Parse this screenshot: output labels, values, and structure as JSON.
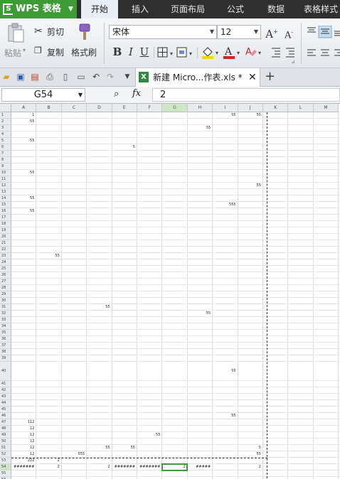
{
  "app": {
    "name": "WPS 表格",
    "logo": "S"
  },
  "menu": {
    "tabs": [
      "开始",
      "插入",
      "页面布局",
      "公式",
      "数据",
      "表格样式"
    ]
  },
  "ribbon": {
    "paste": "粘贴",
    "cut": "剪切",
    "copy": "复制",
    "format_painter": "格式刷",
    "font_name": "宋体",
    "font_size": "12",
    "bold": "B",
    "italic": "I",
    "underline": "U",
    "grow_font": "A",
    "shrink_font": "A"
  },
  "doc_tab": {
    "name": "新建 Micro...作表.xls *",
    "close": "✕",
    "new": "+"
  },
  "formula_bar": {
    "cell_ref": "G54",
    "fx": "fx",
    "value": "2"
  },
  "grid": {
    "columns": [
      "A",
      "B",
      "C",
      "D",
      "E",
      "F",
      "G",
      "H",
      "I",
      "J",
      "K",
      "L",
      "M"
    ],
    "rows": [
      "1",
      "2",
      "3",
      "4",
      "5",
      "6",
      "7",
      "8",
      "9",
      "10",
      "11",
      "12",
      "13",
      "14",
      "15",
      "16",
      "17",
      "18",
      "19",
      "20",
      "21",
      "22",
      "23",
      "24",
      "25",
      "26",
      "27",
      "28",
      "29",
      "30",
      "31",
      "32",
      "33",
      "34",
      "35",
      "36",
      "37",
      "38",
      "39",
      "40",
      "41",
      "42",
      "43",
      "44",
      "45",
      "46",
      "47",
      "48",
      "49",
      "50",
      "51",
      "52",
      "53",
      "54",
      "55",
      "56"
    ],
    "selected": "G54",
    "cells": [
      {
        "col": "A",
        "row": "1",
        "value": "1"
      },
      {
        "col": "A",
        "row": "2",
        "value": "55"
      },
      {
        "col": "A",
        "row": "5",
        "value": "55"
      },
      {
        "col": "A",
        "row": "10",
        "value": "55"
      },
      {
        "col": "A",
        "row": "14",
        "value": "55"
      },
      {
        "col": "A",
        "row": "16",
        "value": "55"
      },
      {
        "col": "A",
        "row": "47",
        "value": "112"
      },
      {
        "col": "A",
        "row": "48",
        "value": "12"
      },
      {
        "col": "A",
        "row": "49",
        "value": "12"
      },
      {
        "col": "A",
        "row": "50",
        "value": "12"
      },
      {
        "col": "A",
        "row": "51",
        "value": "12"
      },
      {
        "col": "A",
        "row": "52",
        "value": "12"
      },
      {
        "col": "A",
        "row": "53",
        "value": "222"
      },
      {
        "col": "A",
        "row": "54",
        "value": "#######"
      },
      {
        "col": "B",
        "row": "23",
        "value": "55"
      },
      {
        "col": "B",
        "row": "53",
        "value": "2"
      },
      {
        "col": "B",
        "row": "54",
        "value": "2"
      },
      {
        "col": "C",
        "row": "52",
        "value": "555"
      },
      {
        "col": "D",
        "row": "31",
        "value": "55"
      },
      {
        "col": "D",
        "row": "51",
        "value": "55"
      },
      {
        "col": "D",
        "row": "54",
        "value": "2"
      },
      {
        "col": "E",
        "row": "6",
        "value": "5"
      },
      {
        "col": "E",
        "row": "51",
        "value": "55"
      },
      {
        "col": "E",
        "row": "54",
        "value": "#######"
      },
      {
        "col": "F",
        "row": "49",
        "value": "55"
      },
      {
        "col": "F",
        "row": "54",
        "value": "#######"
      },
      {
        "col": "G",
        "row": "54",
        "value": "2"
      },
      {
        "col": "H",
        "row": "3",
        "value": "55"
      },
      {
        "col": "H",
        "row": "32",
        "value": "55"
      },
      {
        "col": "H",
        "row": "54",
        "value": "#####"
      },
      {
        "col": "I",
        "row": "1",
        "value": "55"
      },
      {
        "col": "I",
        "row": "15",
        "value": "555"
      },
      {
        "col": "I",
        "row": "40",
        "value": "55"
      },
      {
        "col": "I",
        "row": "46",
        "value": "55"
      },
      {
        "col": "J",
        "row": "1",
        "value": "55"
      },
      {
        "col": "J",
        "row": "12",
        "value": "55"
      },
      {
        "col": "J",
        "row": "51",
        "value": "5"
      },
      {
        "col": "J",
        "row": "52",
        "value": "55"
      },
      {
        "col": "J",
        "row": "54",
        "value": "2"
      }
    ]
  }
}
